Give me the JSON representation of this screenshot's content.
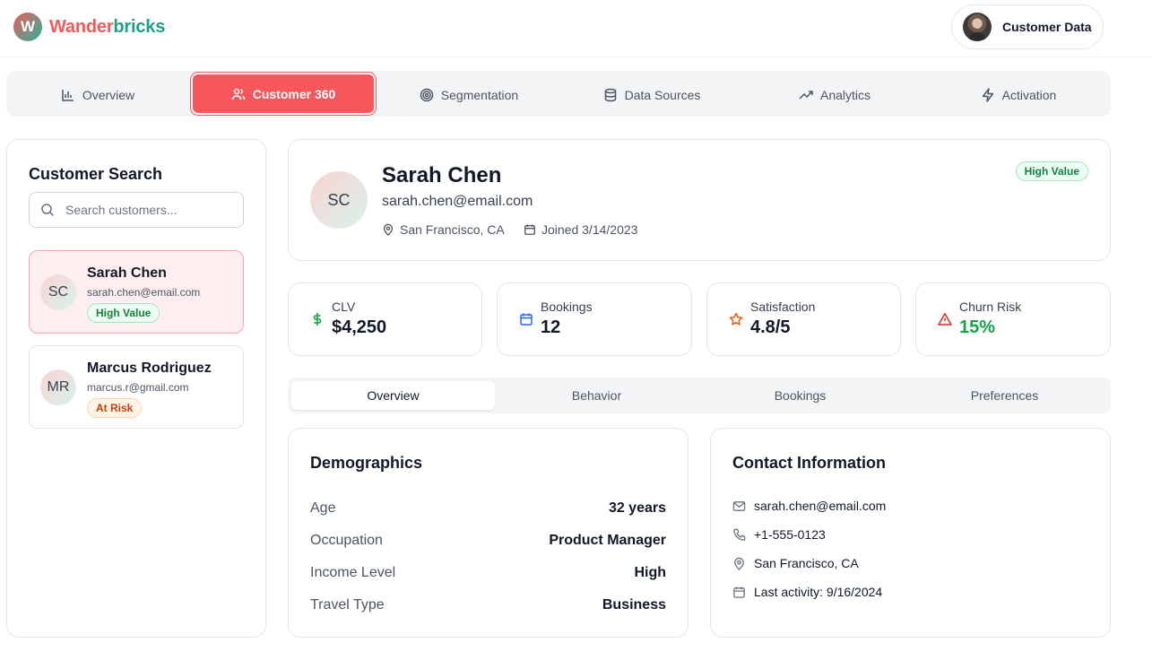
{
  "header": {
    "logo_letter": "W",
    "brand_part1": "Wander",
    "brand_part2": "bricks",
    "user_label": "Customer Data"
  },
  "nav": {
    "tabs": [
      {
        "label": "Overview",
        "icon": "bar-chart-icon"
      },
      {
        "label": "Customer 360",
        "icon": "users-icon",
        "active": true
      },
      {
        "label": "Segmentation",
        "icon": "target-icon"
      },
      {
        "label": "Data Sources",
        "icon": "database-icon"
      },
      {
        "label": "Analytics",
        "icon": "trending-up-icon"
      },
      {
        "label": "Activation",
        "icon": "lightning-icon"
      }
    ]
  },
  "sidebar": {
    "title": "Customer Search",
    "search_placeholder": "Search customers...",
    "customers": [
      {
        "initials": "SC",
        "name": "Sarah Chen",
        "email": "sarah.chen@email.com",
        "badge": "High Value",
        "selected": true
      },
      {
        "initials": "MR",
        "name": "Marcus Rodriguez",
        "email": "marcus.r@gmail.com",
        "badge": "At Risk",
        "selected": false
      }
    ]
  },
  "profile": {
    "initials": "SC",
    "name": "Sarah Chen",
    "email": "sarah.chen@email.com",
    "location": "San Francisco, CA",
    "joined": "Joined 3/14/2023",
    "badge": "High Value"
  },
  "stats": [
    {
      "label": "CLV",
      "value": "$4,250",
      "icon": "dollar-icon",
      "color": "#16a34a"
    },
    {
      "label": "Bookings",
      "value": "12",
      "icon": "calendar-icon",
      "color": "#2563eb"
    },
    {
      "label": "Satisfaction",
      "value": "4.8/5",
      "icon": "star-icon",
      "color": "#ea580c"
    },
    {
      "label": "Churn Risk",
      "value": "15%",
      "icon": "alert-triangle-icon",
      "color": "#dc2626",
      "value_color": "#16a34a"
    }
  ],
  "subtabs": [
    {
      "label": "Overview",
      "active": true
    },
    {
      "label": "Behavior"
    },
    {
      "label": "Bookings"
    },
    {
      "label": "Preferences"
    }
  ],
  "demographics": {
    "title": "Demographics",
    "rows": [
      {
        "label": "Age",
        "value": "32 years"
      },
      {
        "label": "Occupation",
        "value": "Product Manager"
      },
      {
        "label": "Income Level",
        "value": "High"
      },
      {
        "label": "Travel Type",
        "value": "Business"
      }
    ]
  },
  "contact": {
    "title": "Contact Information",
    "items": [
      {
        "icon": "mail-icon",
        "text": "sarah.chen@email.com"
      },
      {
        "icon": "phone-icon",
        "text": "+1-555-0123"
      },
      {
        "icon": "map-pin-icon",
        "text": "San Francisco, CA"
      },
      {
        "icon": "calendar-icon",
        "text": "Last activity: 9/16/2024"
      }
    ]
  },
  "colors": {
    "brand_red": "#f7575c",
    "brand_teal": "#1f9f8a"
  }
}
